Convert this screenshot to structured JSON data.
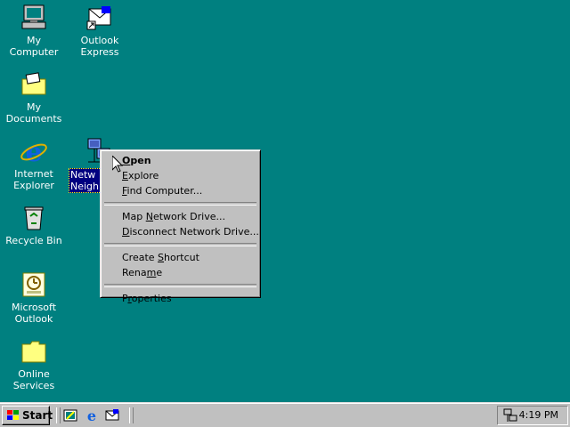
{
  "desktop": {
    "icons": [
      {
        "label_lines": [
          "My Computer"
        ]
      },
      {
        "label_lines": [
          "Outlook",
          "Express"
        ]
      },
      {
        "label_lines": [
          "My Documents"
        ]
      },
      {
        "label_lines": [
          "Internet",
          "Explorer"
        ]
      },
      {
        "label_lines": [
          "Netw",
          "Neighb"
        ]
      },
      {
        "label_lines": [
          "Recycle Bin"
        ]
      },
      {
        "label_lines": [
          "Microsoft",
          "Outlook"
        ]
      },
      {
        "label_lines": [
          "Online",
          "Services"
        ]
      }
    ]
  },
  "context_menu": {
    "items": [
      {
        "label_pre": "",
        "label_key": "O",
        "label_post": "pen"
      },
      {
        "label_pre": "",
        "label_key": "E",
        "label_post": "xplore"
      },
      {
        "label_pre": "",
        "label_key": "F",
        "label_post": "ind Computer..."
      },
      {
        "label_pre": "Map ",
        "label_key": "N",
        "label_post": "etwork Drive..."
      },
      {
        "label_pre": "",
        "label_key": "D",
        "label_post": "isconnect Network Drive..."
      },
      {
        "label_pre": "Create ",
        "label_key": "S",
        "label_post": "hortcut"
      },
      {
        "label_pre": "Rena",
        "label_key": "m",
        "label_post": "e"
      },
      {
        "label_pre": "P",
        "label_key": "r",
        "label_post": "operties"
      }
    ]
  },
  "taskbar": {
    "start_label": "Start",
    "clock": "4:19 PM"
  },
  "colors": {
    "desktop": "#008080",
    "selection": "#000080",
    "face": "#c0c0c0"
  }
}
